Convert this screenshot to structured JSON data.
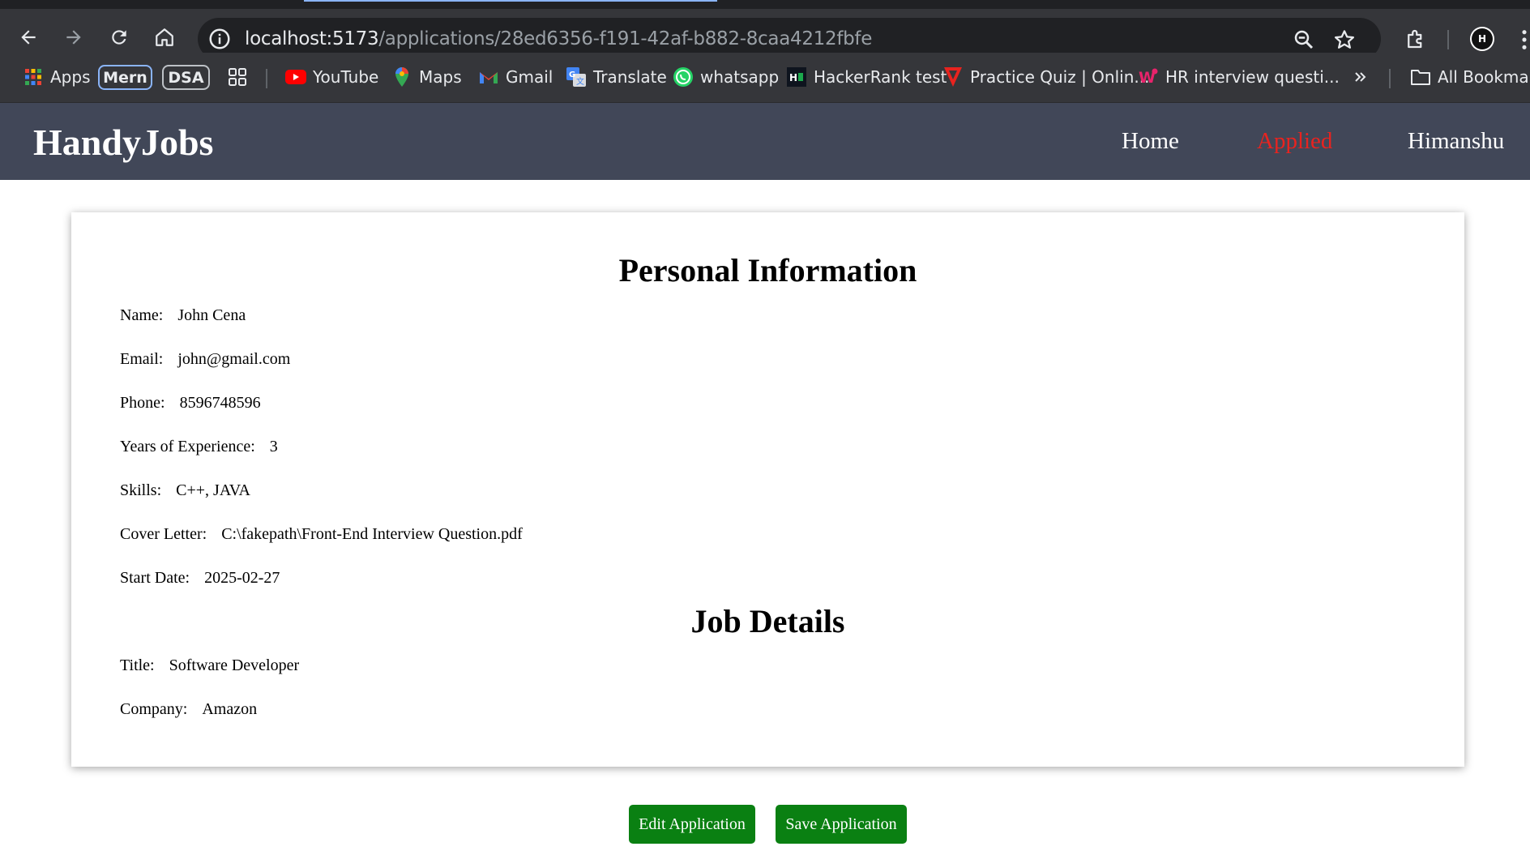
{
  "browser": {
    "url_host": "localhost:5173",
    "url_path": "/applications/28ed6356-f191-42af-b882-8caa4212fbfe",
    "bookmarks": [
      {
        "label": "Apps",
        "icon": "apps-grid-icon"
      },
      {
        "label": "Mern",
        "icon": ""
      },
      {
        "label": "DSA",
        "icon": ""
      },
      {
        "label": "YouTube",
        "icon": "youtube-icon"
      },
      {
        "label": "Maps",
        "icon": "maps-icon"
      },
      {
        "label": "Gmail",
        "icon": "gmail-icon"
      },
      {
        "label": "Translate",
        "icon": "translate-icon"
      },
      {
        "label": "whatsapp",
        "icon": "whatsapp-icon"
      },
      {
        "label": "HackerRank test",
        "icon": "hackerrank-icon"
      },
      {
        "label": "Practice Quiz | Onlin...",
        "icon": "quiz-icon"
      },
      {
        "label": "HR interview questi...",
        "icon": "w-icon"
      },
      {
        "label": "All Bookmarks",
        "icon": "folder-icon"
      }
    ],
    "avatar_text": "H"
  },
  "header": {
    "brand": "HandyJobs",
    "nav": [
      {
        "label": "Home"
      },
      {
        "label": "Applied"
      },
      {
        "label": "Himanshu"
      }
    ],
    "active_color": "#e8231f",
    "background": "#414758"
  },
  "personal": {
    "title": "Personal Information",
    "fields": [
      {
        "label": "Name:",
        "value": "John Cena"
      },
      {
        "label": "Email:",
        "value": "john@gmail.com"
      },
      {
        "label": "Phone:",
        "value": "8596748596"
      },
      {
        "label": "Years of Experience:",
        "value": "3"
      },
      {
        "label": "Skills:",
        "value": "C++, JAVA"
      },
      {
        "label": "Cover Letter:",
        "value": "C:\\fakepath\\Front-End Interview Question.pdf"
      },
      {
        "label": "Start Date:",
        "value": "2025-02-27"
      }
    ]
  },
  "job": {
    "title": "Job Details",
    "fields": [
      {
        "label": "Title:",
        "value": "Software Developer"
      },
      {
        "label": "Company:",
        "value": "Amazon"
      }
    ]
  },
  "actions": {
    "edit_label": "Edit Application",
    "save_label": "Save Application",
    "button_color": "#0a8012"
  }
}
